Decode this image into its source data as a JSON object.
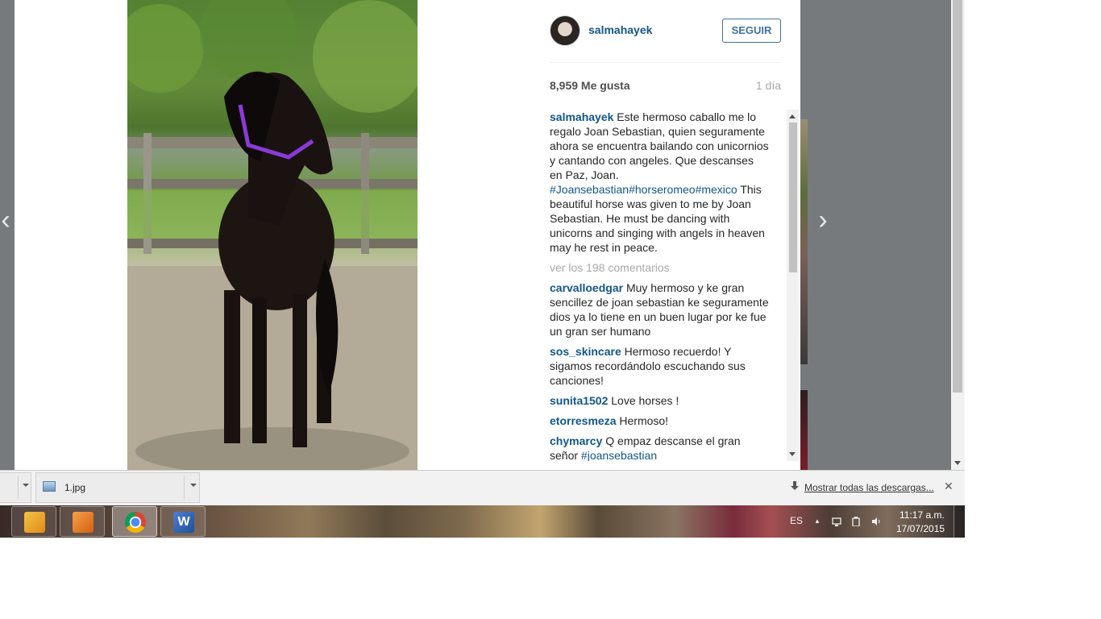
{
  "post": {
    "username": "salmahayek",
    "follow_label": "SEGUIR",
    "likes": "8,959 Me gusta",
    "age": "1 día",
    "caption_user": "salmahayek",
    "caption_text_es": "Este hermoso caballo me lo regalo Joan Sebastian, quien seguramente ahora se encuentra bailando con unicornios y cantando con angeles. Que descanses en Paz, Joan.",
    "caption_tags": "#Joansebastian#horseromeo#mexico",
    "caption_text_en": "This beautiful horse was given to me by Joan Sebastian. He must be dancing with unicorns and singing with angels in heaven may he rest in peace.",
    "view_all": "ver los 198 comentarios"
  },
  "comments": [
    {
      "user": "carvalloedgar",
      "text": "Muy hermoso y ke gran sencillez de joan sebastian ke seguramente dios ya lo tiene en un buen lugar por ke fue un gran ser humano",
      "tag": ""
    },
    {
      "user": "sos_skincare",
      "text": "Hermoso recuerdo! Y sigamos recordándolo escuchando sus canciones!",
      "tag": ""
    },
    {
      "user": "sunita1502",
      "text": "Love horses !",
      "tag": ""
    },
    {
      "user": "etorresmeza",
      "text": "Hermoso!",
      "tag": ""
    },
    {
      "user": "chymarcy",
      "text": "Q empaz descanse el gran señor",
      "tag": "#joansebastian"
    }
  ],
  "nav": {
    "prev_glyph": "‹",
    "next_glyph": "›"
  },
  "downloads": {
    "file_name": "1.jpg",
    "show_all": "Mostrar todas las descargas...",
    "close_glyph": "✕"
  },
  "taskbar": {
    "word_glyph": "W",
    "language": "ES",
    "tray_up_glyph": "▲",
    "time": "11:17 a.m.",
    "date": "17/07/2015"
  },
  "icons": [
    "avatar",
    "outlook-icon",
    "media-player-icon",
    "chrome-icon",
    "word-icon",
    "network-icon",
    "power-icon",
    "volume-icon",
    "download-icon"
  ]
}
